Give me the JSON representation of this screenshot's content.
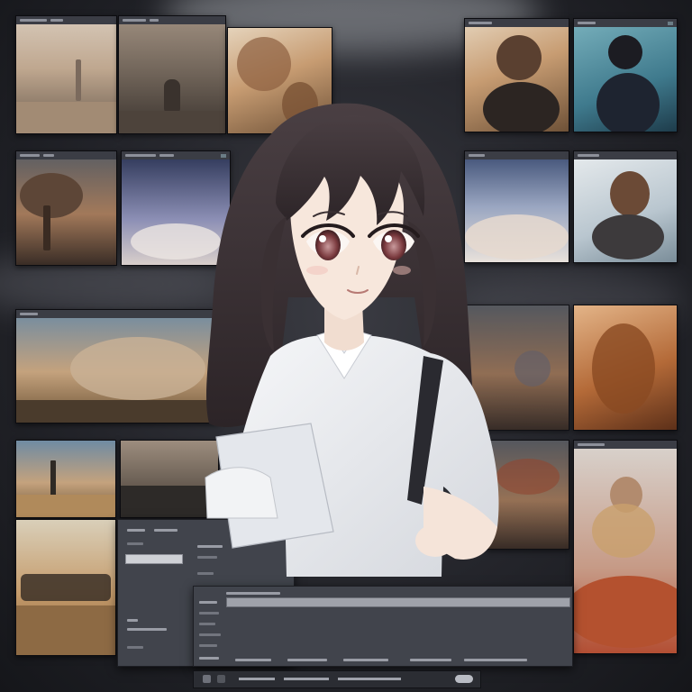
{
  "scene": {
    "description_tiles": [
      {
        "theme": "sepia-cityscape"
      },
      {
        "theme": "smoky-ruins-figure"
      },
      {
        "theme": "sepia-portrait"
      },
      {
        "theme": "brown-haired-anime-boy"
      },
      {
        "theme": "dark-haired-anime-boy-teal"
      },
      {
        "theme": "windswept-tree"
      },
      {
        "theme": "twilight-clouds"
      },
      {
        "theme": "blue-sky-landscape"
      },
      {
        "theme": "brown-haired-girl-sky"
      },
      {
        "theme": "cloudy-tree-landscape"
      },
      {
        "theme": "stormy-sky"
      },
      {
        "theme": "amber-figure-painting"
      },
      {
        "theme": "windmill-field"
      },
      {
        "theme": "dark-landscape"
      },
      {
        "theme": "golden-field-riders"
      },
      {
        "theme": "angel-figure-red-sea"
      }
    ]
  },
  "colors": {
    "background": "#24252b",
    "panel": "#41444c",
    "hair": "#3a3033",
    "shirt": "#eef0f3",
    "skin": "#f5e4d9",
    "eyes": "#7a3a3e"
  }
}
